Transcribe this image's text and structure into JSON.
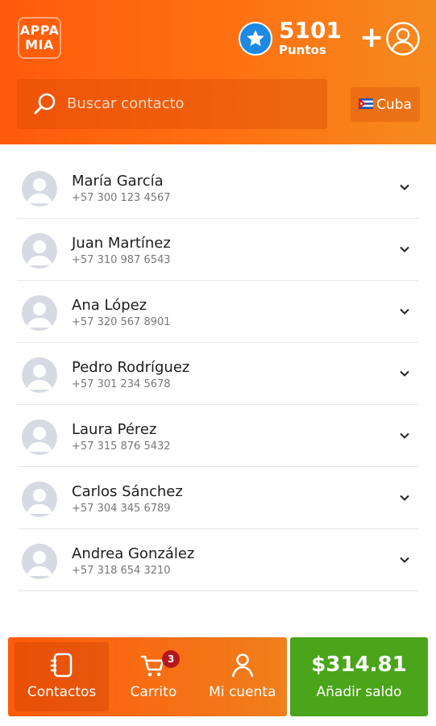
{
  "header": {
    "logo_line1": "APPA",
    "logo_line2": "MIA",
    "points_value": "5101",
    "points_label": "Puntos",
    "plus_symbol": "+",
    "search_placeholder": "Buscar contacto",
    "country_label": "Cuba",
    "brand_color": "#ff5a0a"
  },
  "contacts": [
    {
      "name": "María García",
      "phone": "+57 300 123 4567"
    },
    {
      "name": "Juan Martínez",
      "phone": "+57 310 987 6543"
    },
    {
      "name": "Ana López",
      "phone": "+57 320 567 8901"
    },
    {
      "name": "Pedro Rodríguez",
      "phone": "+57 301 234 5678"
    },
    {
      "name": "Laura Pérez",
      "phone": "+57 315 876 5432"
    },
    {
      "name": "Carlos Sánchez",
      "phone": "+57 304 345 6789"
    },
    {
      "name": "Andrea González",
      "phone": "+57 318 654 3210"
    }
  ],
  "bottom_nav": {
    "contacts_label": "Contactos",
    "cart_label": "Carrito",
    "cart_count": "3",
    "account_label": "Mi cuenta"
  },
  "balance": {
    "amount": "$314.81",
    "label": "Añadir saldo",
    "color": "#4aa51a"
  }
}
